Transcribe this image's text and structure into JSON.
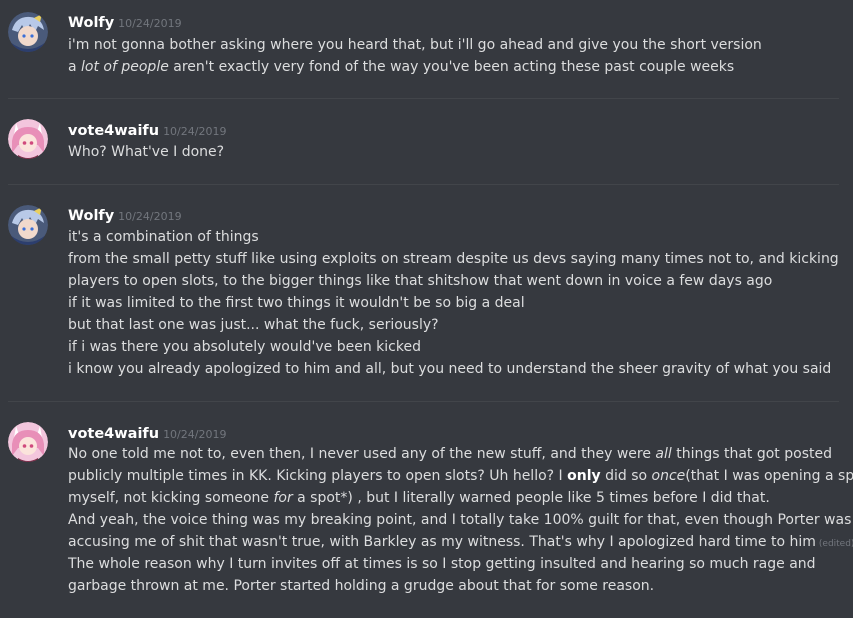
{
  "messages": [
    {
      "author": "Wolfy",
      "timestamp": "10/24/2019",
      "avatar": "wolfy-avatar",
      "lines": [
        "i'm not gonna bother asking where you heard that, but i'll go ahead and give you the short version",
        {
          "pre": "a ",
          "em": "lot of people",
          "post": " aren't exactly very fond of the way you've been acting these past couple weeks"
        }
      ]
    },
    {
      "author": "vote4waifu",
      "timestamp": "10/24/2019",
      "avatar": "vote4waifu-avatar",
      "lines": [
        "Who? What've I done?"
      ]
    },
    {
      "author": "Wolfy",
      "timestamp": "10/24/2019",
      "avatar": "wolfy-avatar",
      "lines": [
        "it's a combination of things",
        "from the small petty stuff like using exploits on stream despite us devs saying many times not to, and kicking",
        "players to open slots, to the bigger things like that shitshow that went down in voice a few days ago",
        "if it was limited to the first two things it wouldn't be so big a deal",
        "but that last one was just... what the fuck, seriously?",
        "if i was there you absolutely would've been kicked",
        "i know you already apologized to him and all, but you need to understand the sheer gravity of what you said"
      ]
    },
    {
      "author": "vote4waifu",
      "timestamp": "10/24/2019",
      "avatar": "vote4waifu-avatar",
      "lines": [
        {
          "pre": "No one told me not to, even then, I never used any of the new stuff, and they were ",
          "em": "all",
          "post": " things that got posted"
        },
        "publicly multiple times in KK. Kicking players to open slots? Uh hello? I ",
        "myself, not kicking someone ",
        "And yeah, the voice thing was my breaking point, and I totally take 100% guilt for that, even though Porter was",
        "accusing me of shit that wasn't true, with Barkley as my witness.  That's why I apologized hard time to him",
        "The whole reason why I turn invites off at times is so I stop getting insulted and hearing so much rage and",
        "garbage thrown at me. Porter started holding a grudge about that for some reason."
      ],
      "line2_bold": "only",
      "line2_mid": " did so ",
      "line2_em": "once",
      "line2_post": "(that I was opening a spot for",
      "line3_em": "for",
      "line3_post": " a spot*) , but I literally warned people like 5 times before I did that.",
      "edited_label": "(edited)"
    }
  ],
  "colors": {
    "background": "#36393f",
    "text": "#dcddde",
    "author": "#ffffff",
    "timestamp": "#72767d"
  }
}
